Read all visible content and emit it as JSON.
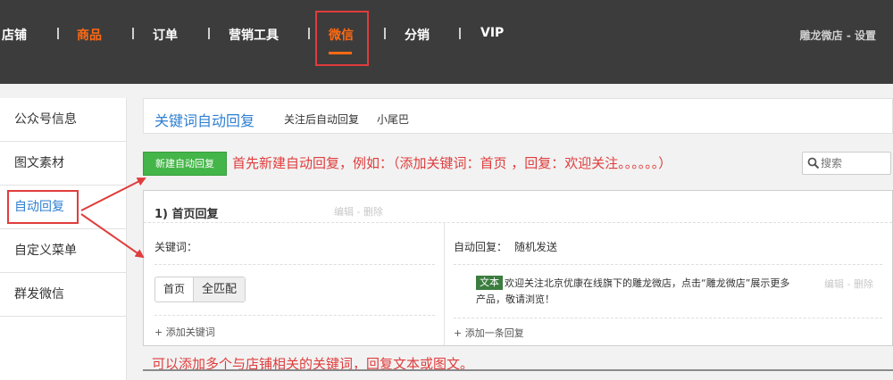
{
  "topnav": {
    "items": [
      {
        "label": "店铺"
      },
      {
        "label": "商品"
      },
      {
        "label": "订单"
      },
      {
        "label": "营销工具"
      },
      {
        "label": "微信"
      },
      {
        "label": "分销"
      },
      {
        "label": "VIP"
      }
    ],
    "active_item": "商品",
    "highlighted_item": "微信",
    "user_text": "雕龙微店 - 设置"
  },
  "sidebar": {
    "items": [
      {
        "label": "公众号信息"
      },
      {
        "label": "图文素材"
      },
      {
        "label": "自动回复"
      },
      {
        "label": "自定义菜单"
      },
      {
        "label": "群发微信"
      }
    ],
    "active_item": "自动回复"
  },
  "header": {
    "title": "关键词自动回复",
    "tabs": [
      {
        "label": "关注后自动回复"
      },
      {
        "label": "小尾巴"
      }
    ]
  },
  "toolbar": {
    "new_button_label": "新建自动回复",
    "search_placeholder": "搜索"
  },
  "rule": {
    "title": "1) 首页回复",
    "actions": "编辑 - 删除",
    "keywords_label": "关键词：",
    "keyword": "首页",
    "match_type": "全匹配",
    "add_keyword": "+ 添加关键词",
    "reply_label": "自动回复：",
    "reply_mode": "随机发送",
    "reply_type": "文本",
    "reply_text": "欢迎关注北京优康在线旗下的雕龙微店，点击“雕龙微店”展示更多产品，敬请浏览！",
    "reply_actions": "编辑 - 删除",
    "add_reply": "+ 添加一条回复"
  },
  "annotations": {
    "step_note": "首先新建自动回复，例如：（添加关键词：首页 ，回复：欢迎关注。。。。。。）",
    "tip_note": "可以添加多个与店铺相关的关键词，回复文本或图文。"
  },
  "colors": {
    "topbar_bg": "#3c3c3c",
    "accent_orange": "#ff6a14",
    "link_blue": "#2f7fd2",
    "button_green": "#44b549",
    "annotation_red": "#e03c3c"
  }
}
